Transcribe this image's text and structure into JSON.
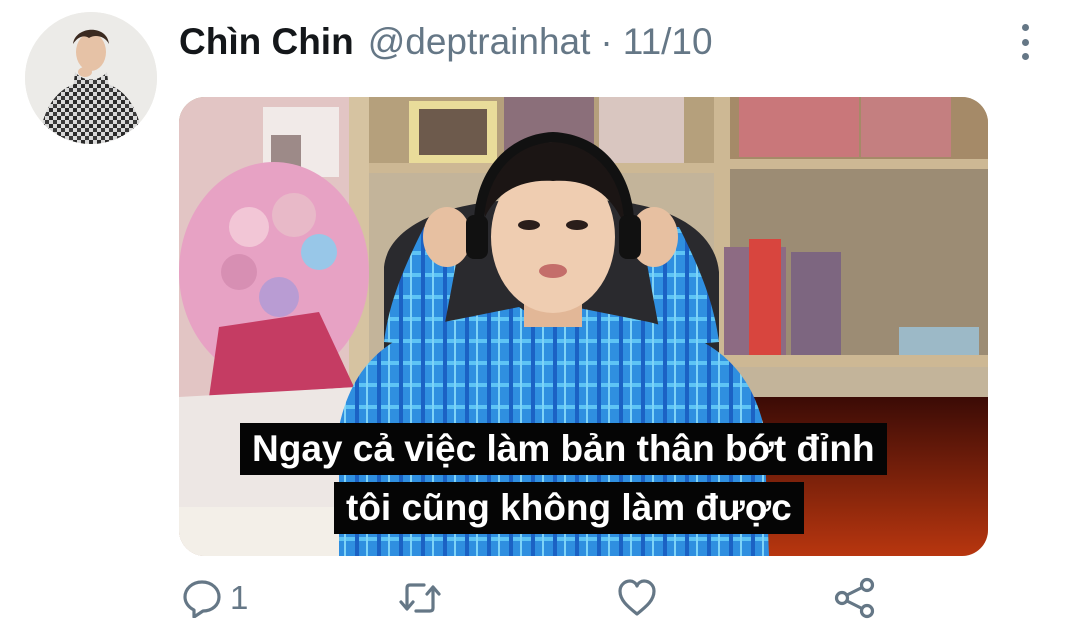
{
  "tweet": {
    "display_name": "Chìn Chin",
    "handle": "@deptrainhat",
    "separator": "·",
    "date": "11/10",
    "media": {
      "caption_line1": "Ngay cả việc làm bản thân bớt đỉnh",
      "caption_line2": "tôi cũng không làm được"
    },
    "actions": {
      "reply_count": "1"
    }
  },
  "colors": {
    "text_primary": "#14171a",
    "text_secondary": "#657786"
  },
  "icons": [
    "more-vertical-icon",
    "reply-icon",
    "retweet-icon",
    "like-icon",
    "share-icon"
  ]
}
